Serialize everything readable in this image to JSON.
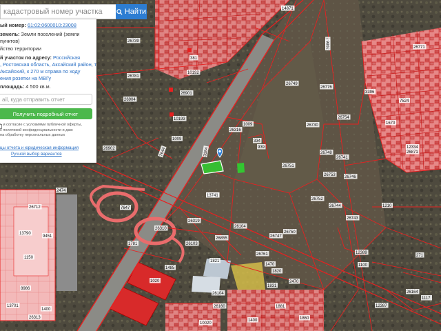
{
  "search": {
    "placeholder": "кадастровый номер участка",
    "button_label": "Найти"
  },
  "panel": {
    "cadastral_label": "ый номер:",
    "cadastral_number": "61:02:0600010:23008",
    "category_label": "земель:",
    "category_value_1": "Земли поселений (земли",
    "category_value_2": "пунктов)",
    "category_value_3": "йство территории",
    "address_label": "й участок по адресу:",
    "address_value_1": "Российская",
    "address_value_2": ", Ростовская область, Аксайский район, т.",
    "address_value_3": "Аксайский, к 270 м справа по ходу",
    "address_value_4": "ения розетки на МВГу",
    "area_label": "площадь:",
    "area_value": "4 500 кв.м.",
    "email_placeholder": "ail, куда отправить отчет",
    "report_button": "Получить подробный отчет",
    "consent_lines": [
      "ь и согласие с условиями публичной оферты,",
      "с политикой конфиденциальности и даю",
      "на обработку персональных данных"
    ],
    "footer_link_1": "цы отчета и юридическая информация",
    "footer_link_2": "Ручной выбор вариантов"
  },
  "map": {
    "parcel_labels": [
      "264",
      "26732",
      "26745",
      "26749",
      "26776",
      "26753",
      "26730",
      "26754",
      "26751",
      "26752",
      "26750",
      "26747",
      "26746",
      "26743",
      "26744",
      "26748",
      "26741",
      "26739",
      "26781",
      "26904",
      "26902",
      "26901",
      "10193",
      "10192",
      "381",
      "1009",
      "7644",
      "7647",
      "26310",
      "26319",
      "26855",
      "26104",
      "26103",
      "1485",
      "1020",
      "1821",
      "26104",
      "10020",
      "26160",
      "26164",
      "1210",
      "271",
      "1100",
      "12387",
      "1117",
      "12389",
      "1781",
      "1009",
      "26316",
      "334",
      "939",
      "3394",
      "3396",
      "26871",
      "1670",
      "12334",
      "26771",
      "26712",
      "13790",
      "13701",
      "8986",
      "1881",
      "1860",
      "1831",
      "2470",
      "7524",
      "1400",
      "1820",
      "1470",
      "26761",
      "1150",
      "9451",
      "2474",
      "26313",
      "1400",
      "14871",
      "3986",
      "13741"
    ]
  },
  "colors": {
    "parcel_outline": "#e82020",
    "residential_fill": "#e96c6c",
    "selected_parcel": "#2fd12f",
    "search_button": "#2d7dd2",
    "report_button": "#4cb84c"
  }
}
